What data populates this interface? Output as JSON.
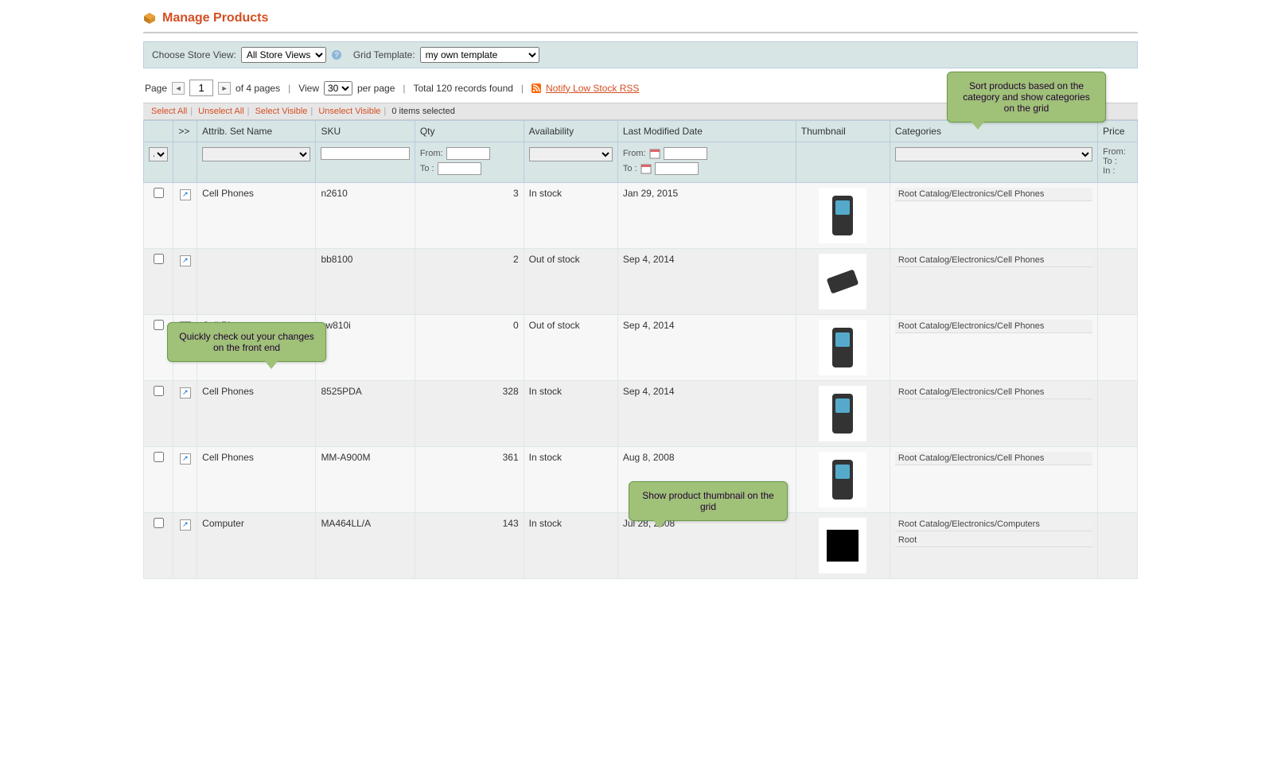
{
  "page": {
    "title": "Manage Products"
  },
  "toolbar": {
    "store_view_label": "Choose Store View:",
    "store_view_value": "All Store Views",
    "grid_template_label": "Grid Template:",
    "grid_template_value": "my own template"
  },
  "pager": {
    "page_label": "Page",
    "page_value": "1",
    "of_pages": "of 4 pages",
    "view_label": "View",
    "per_page_value": "30",
    "per_page_label": "per page",
    "total": "Total 120 records found",
    "rss_link": "Notify Low Stock RSS"
  },
  "massaction": {
    "select_all": "Select All",
    "unselect_all": "Unselect All",
    "select_visible": "Select Visible",
    "unselect_visible": "Unselect Visible",
    "selected": "0 items selected"
  },
  "headers": {
    "expand": ">>",
    "attrib": "Attrib. Set Name",
    "sku": "SKU",
    "qty": "Qty",
    "avail": "Availability",
    "date": "Last Modified Date",
    "thumb": "Thumbnail",
    "cat": "Categories",
    "price": "Price"
  },
  "filters": {
    "any": "Any",
    "from": "From:",
    "to": "To :",
    "in": "In :"
  },
  "rows": [
    {
      "attrib": "Cell Phones",
      "sku": "n2610",
      "qty": "3",
      "avail": "In stock",
      "date": "Jan 29, 2015",
      "cat": [
        "Root Catalog/Electronics/Cell Phones"
      ]
    },
    {
      "attrib": "",
      "sku": "bb8100",
      "qty": "2",
      "avail": "Out of stock",
      "date": "Sep 4, 2014",
      "cat": [
        "Root Catalog/Electronics/Cell Phones"
      ]
    },
    {
      "attrib": "Cell Phones",
      "sku": "sw810i",
      "qty": "0",
      "avail": "Out of stock",
      "date": "Sep 4, 2014",
      "cat": [
        "Root Catalog/Electronics/Cell Phones"
      ]
    },
    {
      "attrib": "Cell Phones",
      "sku": "8525PDA",
      "qty": "328",
      "avail": "In stock",
      "date": "Sep 4, 2014",
      "cat": [
        "Root Catalog/Electronics/Cell Phones"
      ]
    },
    {
      "attrib": "Cell Phones",
      "sku": "MM-A900M",
      "qty": "361",
      "avail": "In stock",
      "date": "Aug 8, 2008",
      "cat": [
        "Root Catalog/Electronics/Cell Phones"
      ]
    },
    {
      "attrib": "Computer",
      "sku": "MA464LL/A",
      "qty": "143",
      "avail": "In stock",
      "date": "Jul 28, 2008",
      "cat": [
        "Root Catalog/Electronics/Computers",
        "Root"
      ]
    }
  ],
  "callouts": {
    "c1": "Sort products based on the category and show categories on the grid",
    "c2": "Quickly check out your changes on the front end",
    "c3": "Show product thumbnail on the grid"
  }
}
